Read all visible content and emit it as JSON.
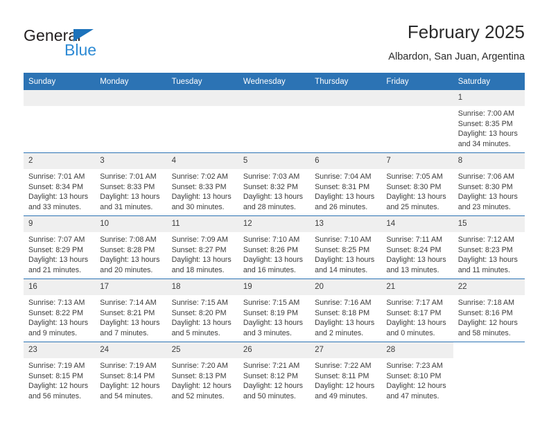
{
  "brand": {
    "name_top": "General",
    "name_bottom": "Blue",
    "triangle_color": "#1c72bb",
    "blue_text_color": "#2d8ad4"
  },
  "header": {
    "title": "February 2025",
    "subtitle": "Albardon, San Juan, Argentina"
  },
  "theme": {
    "header_blue": "#2c73b4",
    "daynum_band": "#efefef",
    "text": "#3b3b3b"
  },
  "weekday_headers": [
    "Sunday",
    "Monday",
    "Tuesday",
    "Wednesday",
    "Thursday",
    "Friday",
    "Saturday"
  ],
  "weeks": [
    [
      {
        "day": "",
        "sunrise": "",
        "sunset": "",
        "daylight1": "",
        "daylight2": ""
      },
      {
        "day": "",
        "sunrise": "",
        "sunset": "",
        "daylight1": "",
        "daylight2": ""
      },
      {
        "day": "",
        "sunrise": "",
        "sunset": "",
        "daylight1": "",
        "daylight2": ""
      },
      {
        "day": "",
        "sunrise": "",
        "sunset": "",
        "daylight1": "",
        "daylight2": ""
      },
      {
        "day": "",
        "sunrise": "",
        "sunset": "",
        "daylight1": "",
        "daylight2": ""
      },
      {
        "day": "",
        "sunrise": "",
        "sunset": "",
        "daylight1": "",
        "daylight2": ""
      },
      {
        "day": "1",
        "sunrise": "Sunrise: 7:00 AM",
        "sunset": "Sunset: 8:35 PM",
        "daylight1": "Daylight: 13 hours",
        "daylight2": "and 34 minutes."
      }
    ],
    [
      {
        "day": "2",
        "sunrise": "Sunrise: 7:01 AM",
        "sunset": "Sunset: 8:34 PM",
        "daylight1": "Daylight: 13 hours",
        "daylight2": "and 33 minutes."
      },
      {
        "day": "3",
        "sunrise": "Sunrise: 7:01 AM",
        "sunset": "Sunset: 8:33 PM",
        "daylight1": "Daylight: 13 hours",
        "daylight2": "and 31 minutes."
      },
      {
        "day": "4",
        "sunrise": "Sunrise: 7:02 AM",
        "sunset": "Sunset: 8:33 PM",
        "daylight1": "Daylight: 13 hours",
        "daylight2": "and 30 minutes."
      },
      {
        "day": "5",
        "sunrise": "Sunrise: 7:03 AM",
        "sunset": "Sunset: 8:32 PM",
        "daylight1": "Daylight: 13 hours",
        "daylight2": "and 28 minutes."
      },
      {
        "day": "6",
        "sunrise": "Sunrise: 7:04 AM",
        "sunset": "Sunset: 8:31 PM",
        "daylight1": "Daylight: 13 hours",
        "daylight2": "and 26 minutes."
      },
      {
        "day": "7",
        "sunrise": "Sunrise: 7:05 AM",
        "sunset": "Sunset: 8:30 PM",
        "daylight1": "Daylight: 13 hours",
        "daylight2": "and 25 minutes."
      },
      {
        "day": "8",
        "sunrise": "Sunrise: 7:06 AM",
        "sunset": "Sunset: 8:30 PM",
        "daylight1": "Daylight: 13 hours",
        "daylight2": "and 23 minutes."
      }
    ],
    [
      {
        "day": "9",
        "sunrise": "Sunrise: 7:07 AM",
        "sunset": "Sunset: 8:29 PM",
        "daylight1": "Daylight: 13 hours",
        "daylight2": "and 21 minutes."
      },
      {
        "day": "10",
        "sunrise": "Sunrise: 7:08 AM",
        "sunset": "Sunset: 8:28 PM",
        "daylight1": "Daylight: 13 hours",
        "daylight2": "and 20 minutes."
      },
      {
        "day": "11",
        "sunrise": "Sunrise: 7:09 AM",
        "sunset": "Sunset: 8:27 PM",
        "daylight1": "Daylight: 13 hours",
        "daylight2": "and 18 minutes."
      },
      {
        "day": "12",
        "sunrise": "Sunrise: 7:10 AM",
        "sunset": "Sunset: 8:26 PM",
        "daylight1": "Daylight: 13 hours",
        "daylight2": "and 16 minutes."
      },
      {
        "day": "13",
        "sunrise": "Sunrise: 7:10 AM",
        "sunset": "Sunset: 8:25 PM",
        "daylight1": "Daylight: 13 hours",
        "daylight2": "and 14 minutes."
      },
      {
        "day": "14",
        "sunrise": "Sunrise: 7:11 AM",
        "sunset": "Sunset: 8:24 PM",
        "daylight1": "Daylight: 13 hours",
        "daylight2": "and 13 minutes."
      },
      {
        "day": "15",
        "sunrise": "Sunrise: 7:12 AM",
        "sunset": "Sunset: 8:23 PM",
        "daylight1": "Daylight: 13 hours",
        "daylight2": "and 11 minutes."
      }
    ],
    [
      {
        "day": "16",
        "sunrise": "Sunrise: 7:13 AM",
        "sunset": "Sunset: 8:22 PM",
        "daylight1": "Daylight: 13 hours",
        "daylight2": "and 9 minutes."
      },
      {
        "day": "17",
        "sunrise": "Sunrise: 7:14 AM",
        "sunset": "Sunset: 8:21 PM",
        "daylight1": "Daylight: 13 hours",
        "daylight2": "and 7 minutes."
      },
      {
        "day": "18",
        "sunrise": "Sunrise: 7:15 AM",
        "sunset": "Sunset: 8:20 PM",
        "daylight1": "Daylight: 13 hours",
        "daylight2": "and 5 minutes."
      },
      {
        "day": "19",
        "sunrise": "Sunrise: 7:15 AM",
        "sunset": "Sunset: 8:19 PM",
        "daylight1": "Daylight: 13 hours",
        "daylight2": "and 3 minutes."
      },
      {
        "day": "20",
        "sunrise": "Sunrise: 7:16 AM",
        "sunset": "Sunset: 8:18 PM",
        "daylight1": "Daylight: 13 hours",
        "daylight2": "and 2 minutes."
      },
      {
        "day": "21",
        "sunrise": "Sunrise: 7:17 AM",
        "sunset": "Sunset: 8:17 PM",
        "daylight1": "Daylight: 13 hours",
        "daylight2": "and 0 minutes."
      },
      {
        "day": "22",
        "sunrise": "Sunrise: 7:18 AM",
        "sunset": "Sunset: 8:16 PM",
        "daylight1": "Daylight: 12 hours",
        "daylight2": "and 58 minutes."
      }
    ],
    [
      {
        "day": "23",
        "sunrise": "Sunrise: 7:19 AM",
        "sunset": "Sunset: 8:15 PM",
        "daylight1": "Daylight: 12 hours",
        "daylight2": "and 56 minutes."
      },
      {
        "day": "24",
        "sunrise": "Sunrise: 7:19 AM",
        "sunset": "Sunset: 8:14 PM",
        "daylight1": "Daylight: 12 hours",
        "daylight2": "and 54 minutes."
      },
      {
        "day": "25",
        "sunrise": "Sunrise: 7:20 AM",
        "sunset": "Sunset: 8:13 PM",
        "daylight1": "Daylight: 12 hours",
        "daylight2": "and 52 minutes."
      },
      {
        "day": "26",
        "sunrise": "Sunrise: 7:21 AM",
        "sunset": "Sunset: 8:12 PM",
        "daylight1": "Daylight: 12 hours",
        "daylight2": "and 50 minutes."
      },
      {
        "day": "27",
        "sunrise": "Sunrise: 7:22 AM",
        "sunset": "Sunset: 8:11 PM",
        "daylight1": "Daylight: 12 hours",
        "daylight2": "and 49 minutes."
      },
      {
        "day": "28",
        "sunrise": "Sunrise: 7:23 AM",
        "sunset": "Sunset: 8:10 PM",
        "daylight1": "Daylight: 12 hours",
        "daylight2": "and 47 minutes."
      },
      {
        "day": "",
        "sunrise": "",
        "sunset": "",
        "daylight1": "",
        "daylight2": ""
      }
    ]
  ]
}
